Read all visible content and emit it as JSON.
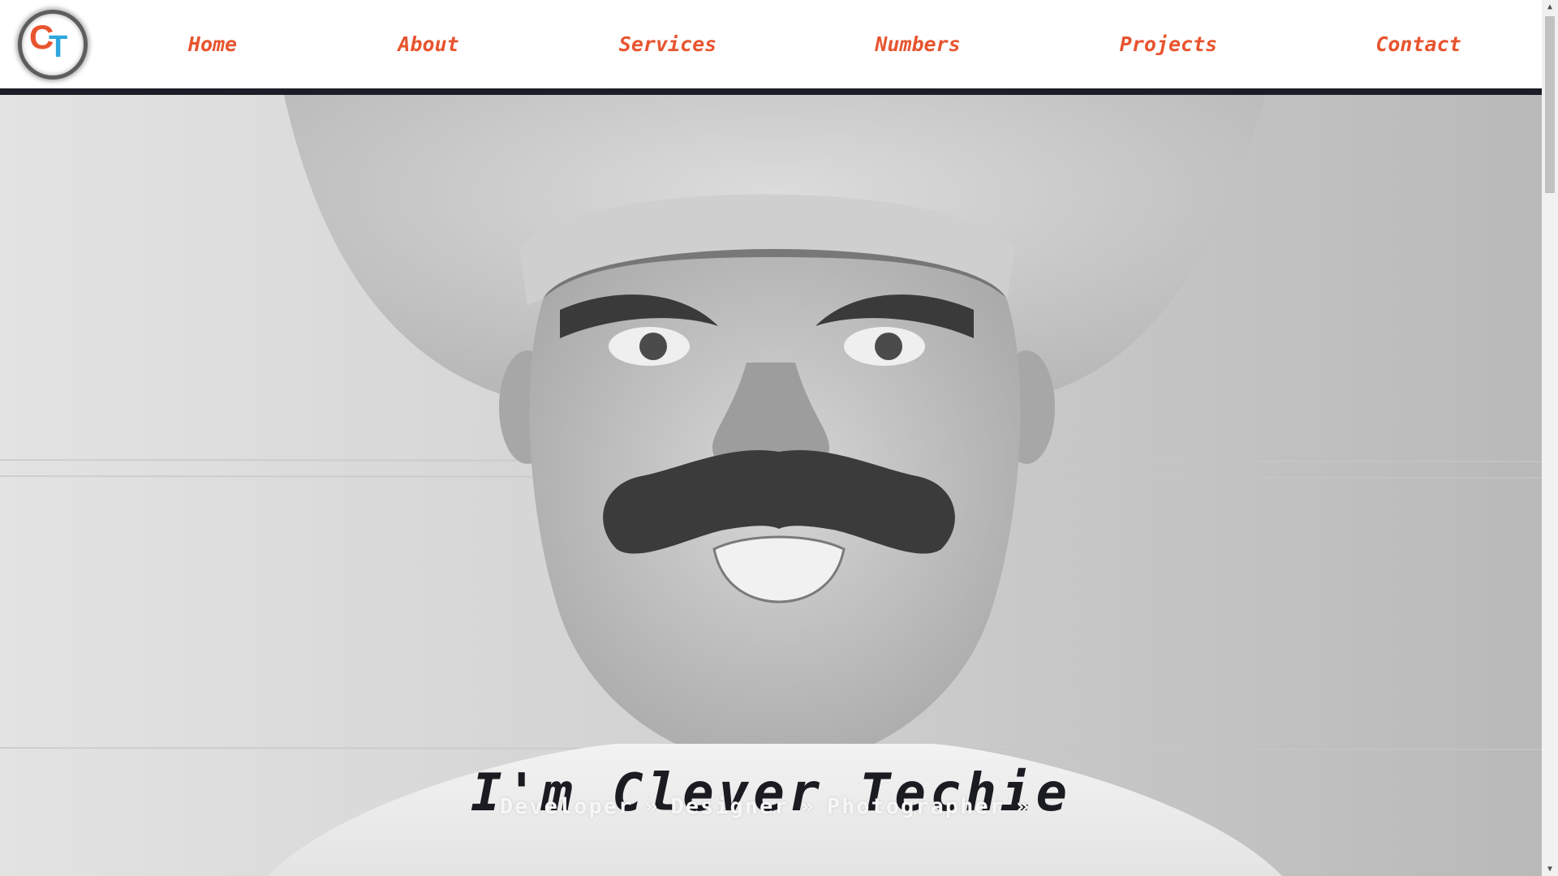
{
  "brand": {
    "logo_letter_1": "C",
    "logo_letter_2": "T",
    "accent": "#e8542e",
    "secondary": "#2fa7de"
  },
  "nav": {
    "items": [
      {
        "label": "Home"
      },
      {
        "label": "About"
      },
      {
        "label": "Services"
      },
      {
        "label": "Numbers"
      },
      {
        "label": "Projects"
      },
      {
        "label": "Contact"
      }
    ]
  },
  "hero": {
    "title": "I'm Clever Techie",
    "roles": [
      "Developer",
      "Designer",
      "Photographer"
    ],
    "separator": "»",
    "image_icon": "portrait-photo-icon"
  },
  "scrollbar": {
    "up_icon": "▲",
    "down_icon": "▼"
  }
}
